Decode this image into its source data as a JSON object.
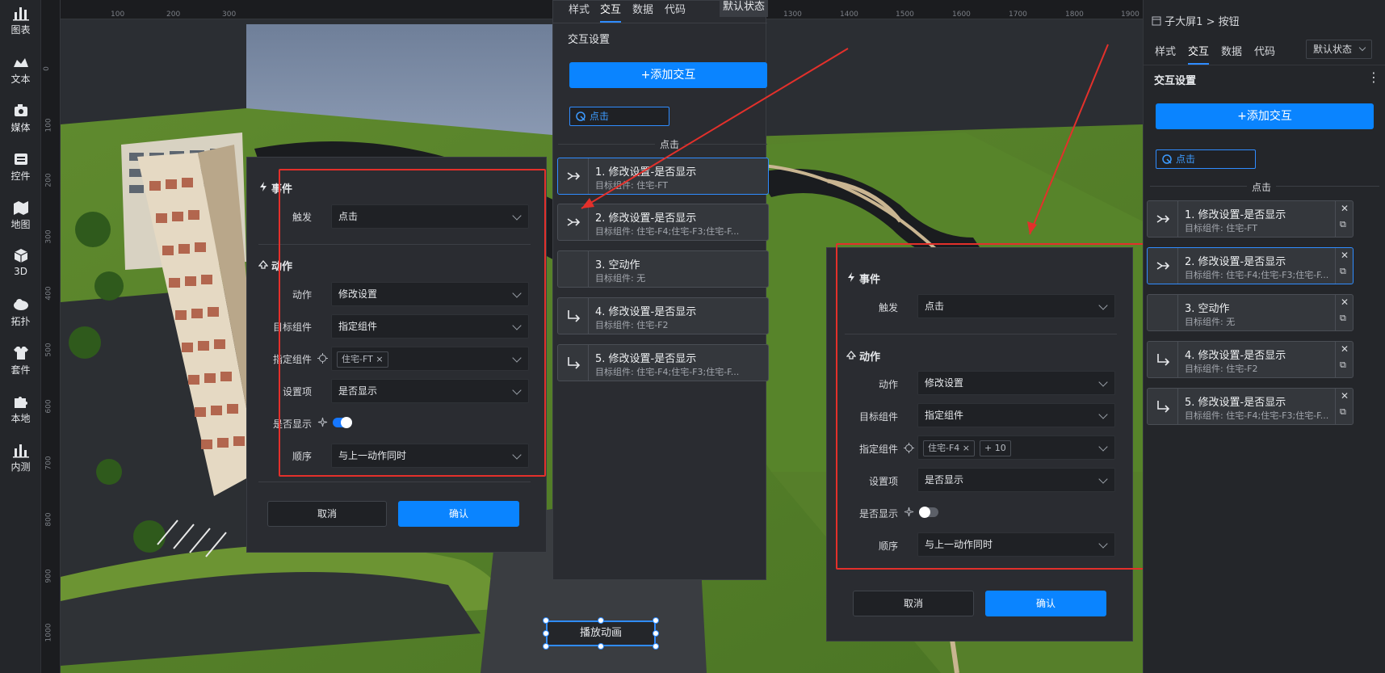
{
  "left_toolbar": [
    {
      "label": "图表",
      "icon": "bar-chart-icon"
    },
    {
      "label": "文本",
      "icon": "text-icon"
    },
    {
      "label": "媒体",
      "icon": "media-icon"
    },
    {
      "label": "控件",
      "icon": "widget-icon"
    },
    {
      "label": "地图",
      "icon": "map-icon"
    },
    {
      "label": "3D",
      "icon": "cube-icon"
    },
    {
      "label": "拓扑",
      "icon": "topology-icon"
    },
    {
      "label": "套件",
      "icon": "kit-icon"
    },
    {
      "label": "本地",
      "icon": "puzzle-icon"
    },
    {
      "label": "内测",
      "icon": "beta-chart-icon"
    }
  ],
  "ruler": {
    "h_ticks": [
      "100",
      "200",
      "300",
      "1300",
      "1400",
      "1500",
      "1600",
      "1700",
      "1800",
      "1900"
    ],
    "v_ticks": [
      "0",
      "100",
      "200",
      "300",
      "400",
      "500",
      "600",
      "700",
      "800",
      "900",
      "1000"
    ]
  },
  "breadcrumb": {
    "root": "子大屏1",
    "sep": ">",
    "current": "按钮"
  },
  "tabs": [
    "样式",
    "交互",
    "数据",
    "代码"
  ],
  "active_tab": "交互",
  "state_select": "默认状态",
  "section_title": "交互设置",
  "add_button": "+添加交互",
  "trigger_chip": "点击",
  "group_label": "点击",
  "interactions": [
    {
      "title": "1. 修改设置-是否显示",
      "target": "目标组件: 住宅-FT",
      "icon": "merge-arrow-icon"
    },
    {
      "title": "2. 修改设置-是否显示",
      "target": "目标组件: 住宅-F4;住宅-F3;住宅-F...",
      "icon": "merge-arrow-icon"
    },
    {
      "title": "3. 空动作",
      "target": "目标组件: 无",
      "icon": ""
    },
    {
      "title": "4. 修改设置-是否显示",
      "target": "目标组件: 住宅-F2",
      "icon": "turn-arrow-icon"
    },
    {
      "title": "5. 修改设置-是否显示",
      "target": "目标组件: 住宅-F4;住宅-F3;住宅-F...",
      "icon": "turn-arrow-icon"
    }
  ],
  "dialog_left": {
    "event_title": "事件",
    "trigger_label": "触发",
    "trigger_value": "点击",
    "action_title": "动作",
    "action_label": "动作",
    "action_value": "修改设置",
    "target_label": "目标组件",
    "target_value": "指定组件",
    "spec_label": "指定组件",
    "spec_tag": "住宅-FT",
    "setting_label": "设置项",
    "setting_value": "是否显示",
    "show_label": "是否显示",
    "show_on": true,
    "order_label": "顺序",
    "order_value": "与上一动作同时",
    "cancel": "取消",
    "ok": "确认"
  },
  "dialog_right": {
    "event_title": "事件",
    "trigger_label": "触发",
    "trigger_value": "点击",
    "action_title": "动作",
    "action_label": "动作",
    "action_value": "修改设置",
    "target_label": "目标组件",
    "target_value": "指定组件",
    "spec_label": "指定组件",
    "spec_tag": "住宅-F4",
    "spec_more": "+ 10",
    "setting_label": "设置项",
    "setting_value": "是否显示",
    "show_label": "是否显示",
    "show_on": false,
    "order_label": "顺序",
    "order_value": "与上一动作同时",
    "cancel": "取消",
    "ok": "确认"
  },
  "canvas_button": "播放动画",
  "colors": {
    "accent": "#0a84ff",
    "annotation_red": "#e3302b",
    "panel": "#2a2c31"
  }
}
